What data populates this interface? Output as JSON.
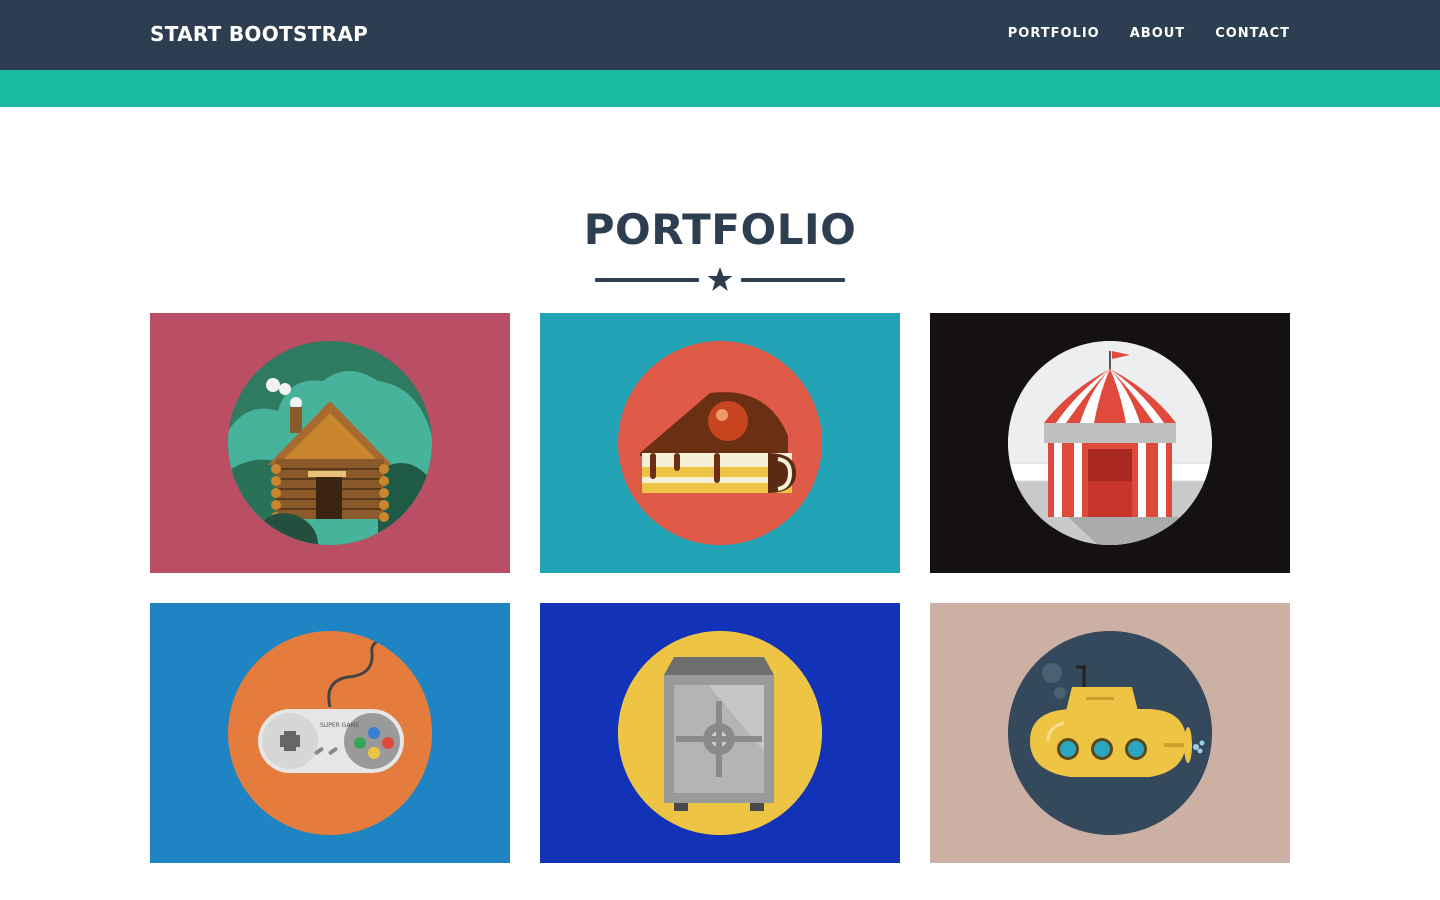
{
  "navbar": {
    "brand": "START BOOTSTRAP",
    "items": [
      {
        "label": "PORTFOLIO"
      },
      {
        "label": "ABOUT"
      },
      {
        "label": "CONTACT"
      }
    ],
    "background": "#2c3e50"
  },
  "accent_band_color": "#18bc9c",
  "portfolio": {
    "title": "PORTFOLIO",
    "divider_icon": "star-icon",
    "items": [
      {
        "icon": "cabin-icon",
        "bg": "#b94e64",
        "circle": "#2f7b61"
      },
      {
        "icon": "cake-icon",
        "bg": "#21a3b5",
        "circle": "#e05a48"
      },
      {
        "icon": "circus-tent-icon",
        "bg": "#141110",
        "circle": "#eceeef"
      },
      {
        "icon": "game-controller-icon",
        "bg": "#1f84c3",
        "circle": "#e37c3d"
      },
      {
        "icon": "safe-icon",
        "bg": "#1233b8",
        "circle": "#eec445"
      },
      {
        "icon": "submarine-icon",
        "bg": "#cbb0a3",
        "circle": "#34495c"
      }
    ]
  }
}
